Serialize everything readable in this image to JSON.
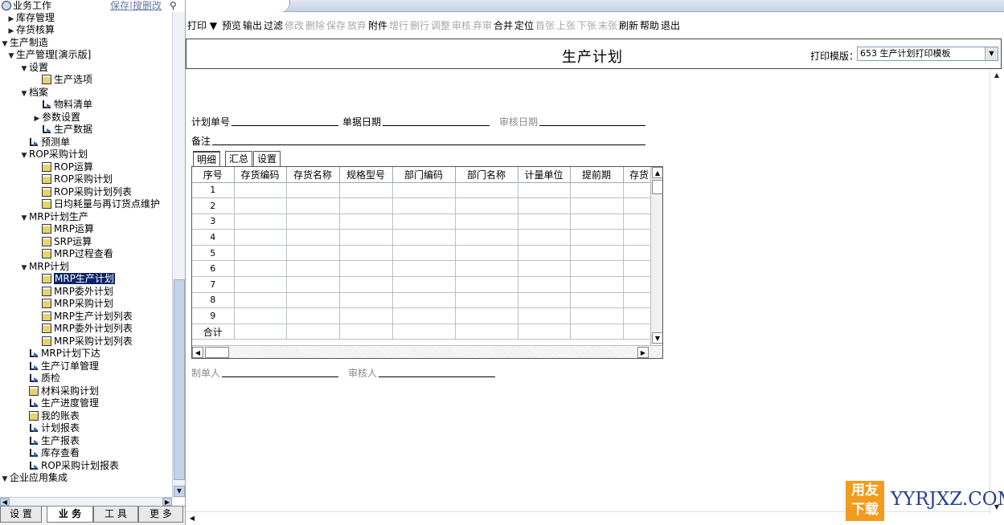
{
  "nav": {
    "title": "业务工作",
    "links": "保存|搜删改",
    "tree": [
      {
        "indent": 0,
        "tw": "▶",
        "icon": "",
        "label": "库存管理"
      },
      {
        "indent": 0,
        "tw": "▶",
        "icon": "",
        "label": "存货核算"
      },
      {
        "indent": -1,
        "tw": "▼",
        "icon": "",
        "label": "生产制造"
      },
      {
        "indent": 0,
        "tw": "▼",
        "icon": "",
        "label": "生产管理[演示版]"
      },
      {
        "indent": 1,
        "tw": "▼",
        "icon": "",
        "label": "设置"
      },
      {
        "indent": 2,
        "tw": "",
        "icon": "doc",
        "label": "生产选项"
      },
      {
        "indent": 1,
        "tw": "▼",
        "icon": "",
        "label": "档案"
      },
      {
        "indent": 2,
        "tw": "",
        "icon": "fld",
        "label": "物料清单"
      },
      {
        "indent": 2,
        "tw": "▶",
        "icon": "",
        "label": "参数设置"
      },
      {
        "indent": 2,
        "tw": "",
        "icon": "fld",
        "label": "生产数据"
      },
      {
        "indent": 1,
        "tw": "",
        "icon": "fld",
        "label": "预测单"
      },
      {
        "indent": 1,
        "tw": "▼",
        "icon": "",
        "label": "ROP采购计划"
      },
      {
        "indent": 2,
        "tw": "",
        "icon": "doc",
        "label": "ROP运算"
      },
      {
        "indent": 2,
        "tw": "",
        "icon": "doc",
        "label": "ROP采购计划"
      },
      {
        "indent": 2,
        "tw": "",
        "icon": "doc",
        "label": "ROP采购计划列表"
      },
      {
        "indent": 2,
        "tw": "",
        "icon": "doc",
        "label": "日均耗量与再订货点维护"
      },
      {
        "indent": 1,
        "tw": "▼",
        "icon": "",
        "label": "MRP计划生产"
      },
      {
        "indent": 2,
        "tw": "",
        "icon": "doc",
        "label": "MRP运算"
      },
      {
        "indent": 2,
        "tw": "",
        "icon": "doc",
        "label": "SRP运算"
      },
      {
        "indent": 2,
        "tw": "",
        "icon": "doc",
        "label": "MRP过程查看"
      },
      {
        "indent": 1,
        "tw": "▼",
        "icon": "",
        "label": "MRP计划"
      },
      {
        "indent": 2,
        "tw": "",
        "icon": "doc",
        "label": "MRP生产计划",
        "selected": true
      },
      {
        "indent": 2,
        "tw": "",
        "icon": "doc",
        "label": "MRP委外计划"
      },
      {
        "indent": 2,
        "tw": "",
        "icon": "doc",
        "label": "MRP采购计划"
      },
      {
        "indent": 2,
        "tw": "",
        "icon": "doc",
        "label": "MRP生产计划列表"
      },
      {
        "indent": 2,
        "tw": "",
        "icon": "doc",
        "label": "MRP委外计划列表"
      },
      {
        "indent": 2,
        "tw": "",
        "icon": "doc",
        "label": "MRP采购计划列表"
      },
      {
        "indent": 1,
        "tw": "",
        "icon": "fld",
        "label": "MRP计划下达"
      },
      {
        "indent": 1,
        "tw": "",
        "icon": "fld",
        "label": "生产订单管理"
      },
      {
        "indent": 1,
        "tw": "",
        "icon": "fld",
        "label": "质检"
      },
      {
        "indent": 1,
        "tw": "",
        "icon": "doc",
        "label": "材料采购计划"
      },
      {
        "indent": 1,
        "tw": "",
        "icon": "fld",
        "label": "生产进度管理"
      },
      {
        "indent": 1,
        "tw": "",
        "icon": "doc",
        "label": "我的账表"
      },
      {
        "indent": 1,
        "tw": "",
        "icon": "fld",
        "label": "计划报表"
      },
      {
        "indent": 1,
        "tw": "",
        "icon": "fld",
        "label": "生产报表"
      },
      {
        "indent": 1,
        "tw": "",
        "icon": "fld",
        "label": "库存查看"
      },
      {
        "indent": 1,
        "tw": "",
        "icon": "fld",
        "label": "ROP采购计划报表"
      },
      {
        "indent": -1,
        "tw": "▼",
        "icon": "",
        "label": "企业应用集成"
      }
    ],
    "bottom_tabs": [
      "设 置",
      "业 务",
      "工 具",
      "更 多"
    ]
  },
  "toolbar": [
    {
      "label": "打印 ▼",
      "on": true
    },
    {
      "label": "预览",
      "on": true
    },
    {
      "label": "输出",
      "on": true
    },
    {
      "label": "过滤",
      "on": true
    },
    {
      "label": "修改",
      "on": false
    },
    {
      "label": "删除",
      "on": false
    },
    {
      "label": "保存",
      "on": false
    },
    {
      "label": "放弃",
      "on": false
    },
    {
      "label": "附件",
      "on": true
    },
    {
      "label": "增行",
      "on": false
    },
    {
      "label": "删行",
      "on": false
    },
    {
      "label": "调整",
      "on": false
    },
    {
      "label": "审核",
      "on": false
    },
    {
      "label": "弃审",
      "on": false
    },
    {
      "label": "合并",
      "on": true
    },
    {
      "label": "定位",
      "on": true
    },
    {
      "label": "首张",
      "on": false
    },
    {
      "label": "上张",
      "on": false
    },
    {
      "label": "下张",
      "on": false
    },
    {
      "label": "末张",
      "on": false
    },
    {
      "label": "刷新",
      "on": true
    },
    {
      "label": "帮助",
      "on": true
    },
    {
      "label": "退出",
      "on": true
    }
  ],
  "form": {
    "title": "生产计划",
    "template_label": "打印模版：",
    "template_value": "653 生产计划打印模板",
    "plan_no_label": "计划单号",
    "doc_date_label": "单据日期",
    "audit_date_label": "审核日期",
    "remark_label": "备注",
    "maker_label": "制单人",
    "auditor_label": "审核人"
  },
  "grid_tabs": [
    "明细",
    "汇总",
    "设置"
  ],
  "grid": {
    "columns": [
      "序号",
      "存货编码",
      "存货名称",
      "规格型号",
      "部门编码",
      "部门名称",
      "计量单位",
      "提前期",
      "存货"
    ],
    "rows": [
      "1",
      "2",
      "3",
      "4",
      "5",
      "6",
      "7",
      "8",
      "9"
    ],
    "total_label": "合计"
  },
  "watermark": {
    "box": "用友\n下载",
    "text": "YYRJXZ.COM"
  }
}
